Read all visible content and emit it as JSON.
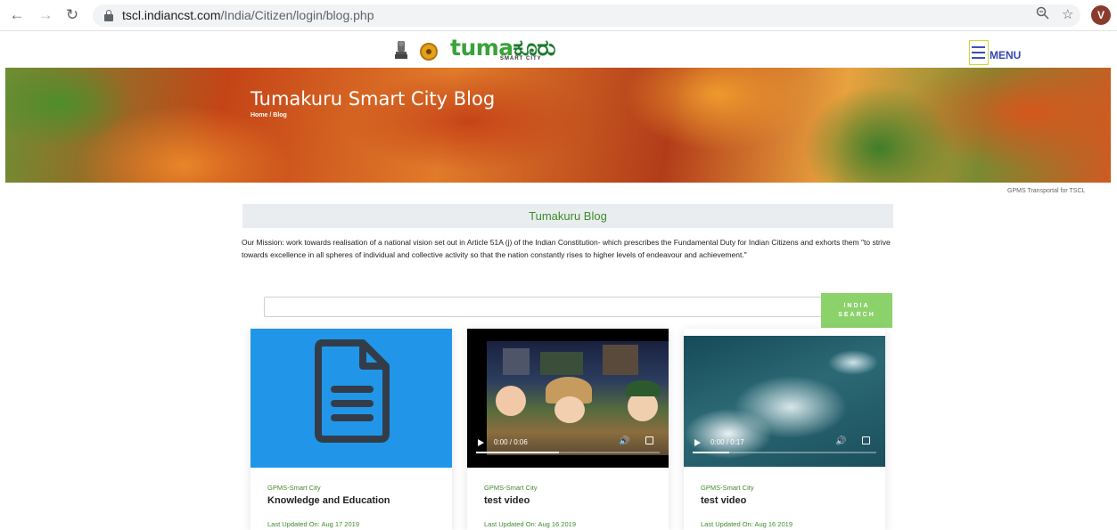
{
  "browser": {
    "url_host": "tscl.indiancst.com",
    "url_path": "/India/Citizen/login/blog.php",
    "profile_initial": "V"
  },
  "header": {
    "logo_word": "tuma",
    "logo_word_kannada": "ಕೂರು",
    "logo_sub": "SMART CITY",
    "menu_label": "MENU"
  },
  "hero": {
    "title": "Tumakuru Smart City Blog",
    "breadcrumb": "Home / Blog"
  },
  "portal_note": "GPMS Transportal for TSCL",
  "blog": {
    "heading": "Tumakuru Blog",
    "mission": "Our Mission: work towards realisation of a national vision set out in Article 51A (j) of the Indian Constitution- which prescribes the Fundamental Duty for Indian Citizens and exhorts them \"to strive towards excellence in all spheres of individual and collective activity so that the nation constantly rises to higher levels of endeavour and achievement.\""
  },
  "search": {
    "placeholder": "",
    "button_line1": "INDIA",
    "button_line2": "SEARCH"
  },
  "colors": {
    "accent_green": "#3e8a2c",
    "search_button": "#8cd26b",
    "doc_card_bg": "#2196e8",
    "menu_blue": "#3546b8"
  },
  "cards": [
    {
      "media": "document-icon",
      "category": "GPMS-Smart City",
      "title": "Knowledge and Education",
      "date": "Last Updated On: Aug 17 2019"
    },
    {
      "media": "video",
      "time": "0:00 / 0:06",
      "progress": 0.45,
      "category": "GPMS-Smart City",
      "title": "test video",
      "date": "Last Updated On: Aug 16 2019"
    },
    {
      "media": "video",
      "time": "0:00 / 0:17",
      "progress": 0.2,
      "category": "GPMS-Smart City",
      "title": "test video",
      "date": "Last Updated On: Aug 16 2019"
    }
  ]
}
